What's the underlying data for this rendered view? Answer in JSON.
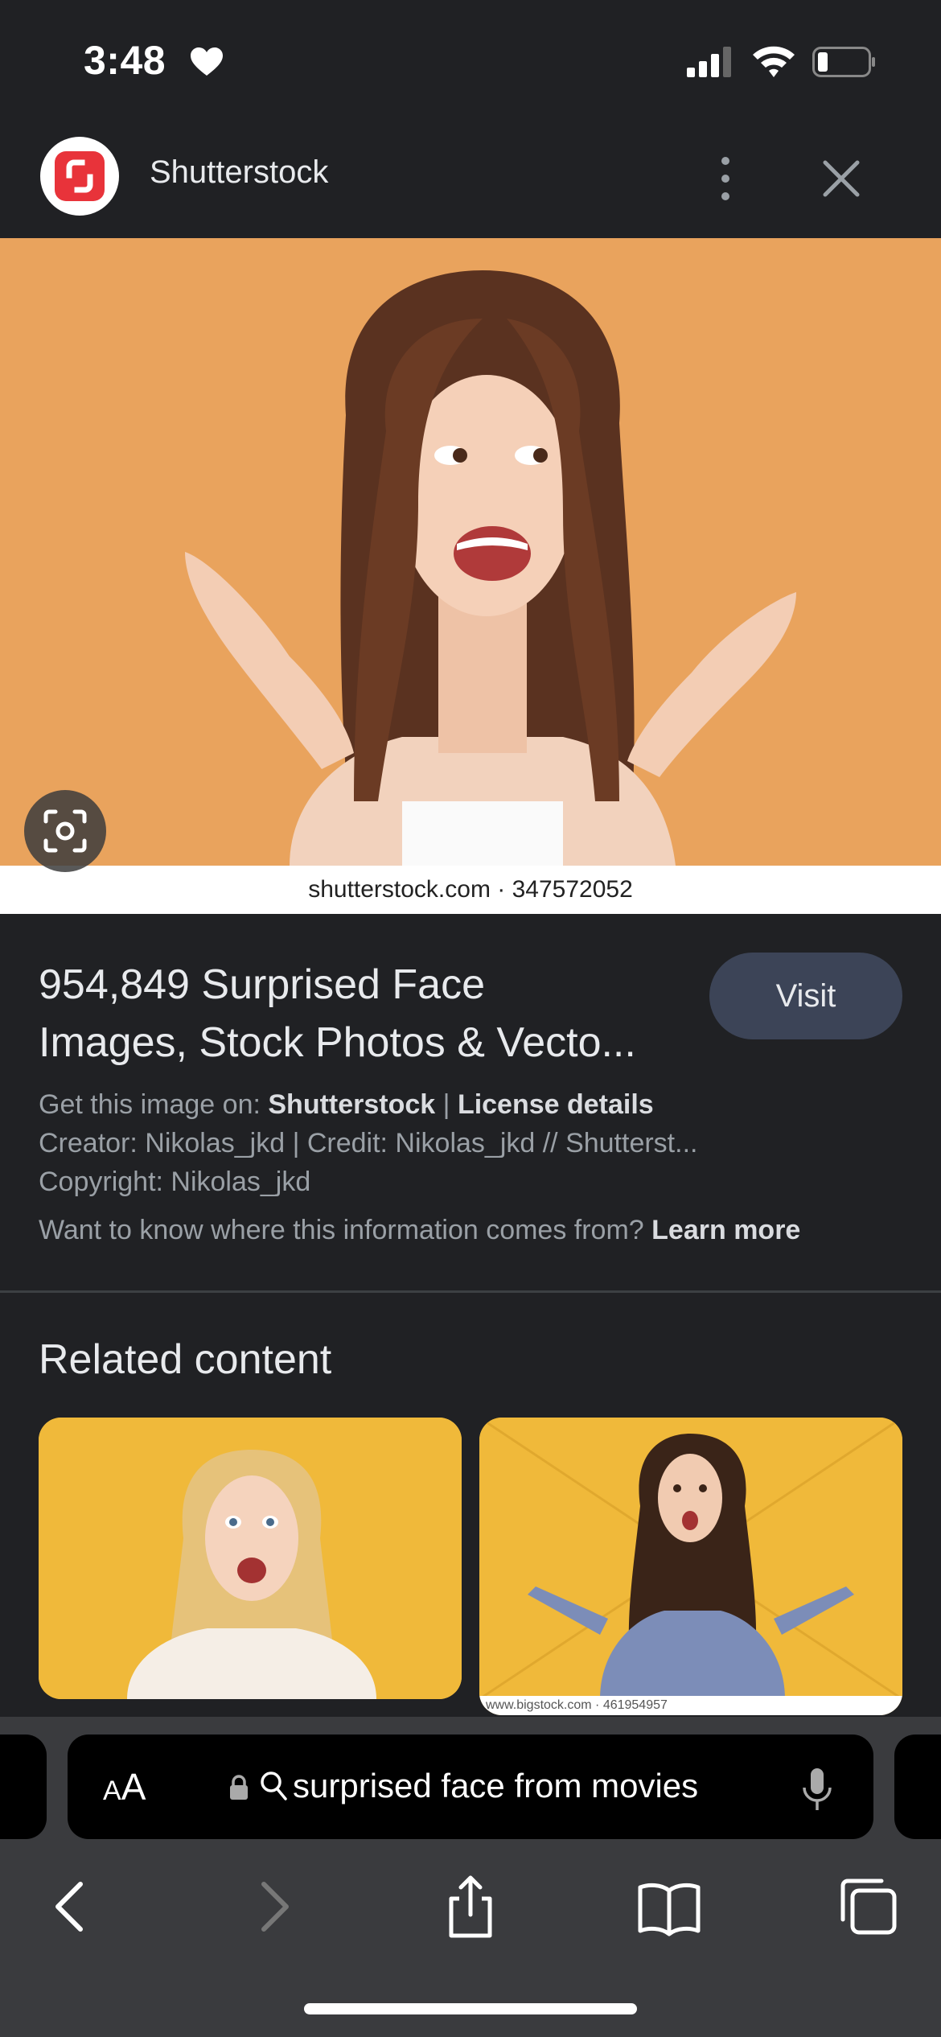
{
  "status_bar": {
    "time": "3:48"
  },
  "header": {
    "site_name": "Shutterstock"
  },
  "hero": {
    "caption": "shutterstock.com · 347572052"
  },
  "info": {
    "title_line1": "954,849 Surprised Face",
    "title_line2": "Images, Stock Photos & Vecto...",
    "visit_label": "Visit",
    "get_image_prefix": "Get this image on: ",
    "get_image_source": "Shutterstock",
    "separator": " | ",
    "license_label": "License details",
    "creator_line": "Creator: Nikolas_jkd | Credit: Nikolas_jkd // Shutterst...",
    "copyright_line": "Copyright: Nikolas_jkd",
    "learn_prefix": "Want to know where this information comes from? ",
    "learn_more_label": "Learn more"
  },
  "related": {
    "heading": "Related content",
    "items": [
      {
        "caption": ""
      },
      {
        "caption": "www.bigstock.com · 461954957"
      }
    ]
  },
  "browser": {
    "aa_large": "A",
    "aa_small": "A",
    "url_text": "surprised face from movies"
  },
  "colors": {
    "background": "#202124",
    "hero_bg": "#e9a35d",
    "thumb_bg": "#f0b93a",
    "visit_bg": "#3c4457",
    "brand_red": "#e8333a"
  }
}
